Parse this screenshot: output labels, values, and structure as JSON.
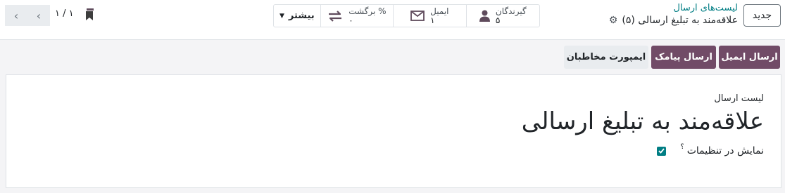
{
  "header": {
    "new_button": "جدید",
    "breadcrumb_parent": "لیست‌های ارسال",
    "breadcrumb_current": "علاقه‌مند به تبلیغ ارسالی (۵)"
  },
  "stats": {
    "recipients": {
      "label": "گیرندگان",
      "value": "۵"
    },
    "email": {
      "label": "ایمیل",
      "value": "۱"
    },
    "bounce": {
      "label": "% برگشت",
      "value": "۰"
    },
    "more": "بیشتر"
  },
  "pager": {
    "value": "۱ / ۱"
  },
  "actions": {
    "send_email": "ارسال ایمیل",
    "send_sms": "ارسال پیامک",
    "import_contacts": "ایمپورت مخاطبان"
  },
  "form": {
    "field_label": "لیست ارسال",
    "title": "علاقه‌مند به تبلیغ ارسالی",
    "show_in_settings_label": "نمایش در تنظیمات",
    "help_mark": "؟",
    "show_in_settings_checked": true
  },
  "colors": {
    "primary": "#714b67",
    "link": "#017e84"
  }
}
